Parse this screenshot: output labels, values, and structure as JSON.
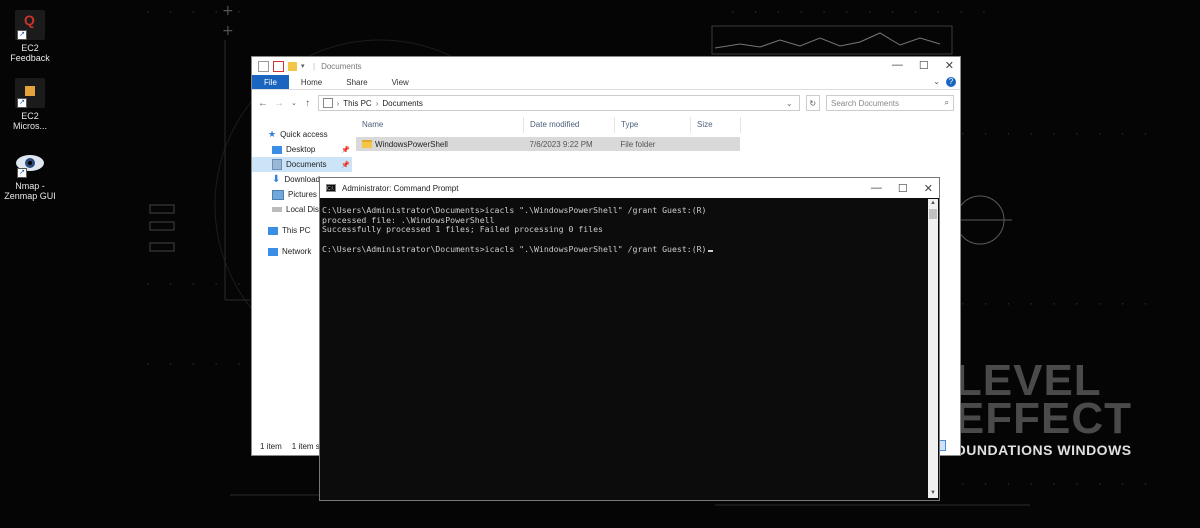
{
  "desktop": {
    "icons": [
      {
        "label": "EC2\nFeedback",
        "icon": "feedback-icon"
      },
      {
        "label": "EC2\nMicros...",
        "icon": "package-icon"
      },
      {
        "label": "Nmap -\nZenmap GUI",
        "icon": "eye-icon"
      }
    ],
    "brand": {
      "line1": "LEVEL",
      "line2": "EFFECT",
      "line3": "OUNDATIONS WINDOWS"
    }
  },
  "explorer": {
    "title": "Documents",
    "ribbon_tabs": [
      "File",
      "Home",
      "Share",
      "View"
    ],
    "breadcrumb": [
      "This PC",
      "Documents"
    ],
    "search_placeholder": "Search Documents",
    "nav_items": [
      {
        "label": "Quick access",
        "icon": "star-icon"
      },
      {
        "label": "Desktop",
        "icon": "desktop-icon",
        "pinned": true
      },
      {
        "label": "Documents",
        "icon": "documents-icon",
        "pinned": true,
        "selected": true
      },
      {
        "label": "Download",
        "icon": "download-icon"
      },
      {
        "label": "Pictures",
        "icon": "pictures-icon"
      },
      {
        "label": "Local Disk",
        "icon": "disk-icon"
      },
      {
        "label": "This PC",
        "icon": "pc-icon"
      },
      {
        "label": "Network",
        "icon": "network-icon"
      }
    ],
    "columns": [
      "Name",
      "Date modified",
      "Type",
      "Size"
    ],
    "files": [
      {
        "name": "WindowsPowerShell",
        "date": "7/6/2023 9:22 PM",
        "type": "File folder",
        "size": ""
      }
    ],
    "status_count": "1 item",
    "status_selected": "1 item s"
  },
  "cmd": {
    "title": "Administrator: Command Prompt",
    "lines": [
      "C:\\Users\\Administrator\\Documents>icacls \".\\WindowsPowerShell\" /grant Guest:(R)",
      "processed file: .\\WindowsPowerShell",
      "Successfully processed 1 files; Failed processing 0 files",
      "",
      "C:\\Users\\Administrator\\Documents>icacls \".\\WindowsPowerShell\" /grant Guest:(R)"
    ]
  }
}
